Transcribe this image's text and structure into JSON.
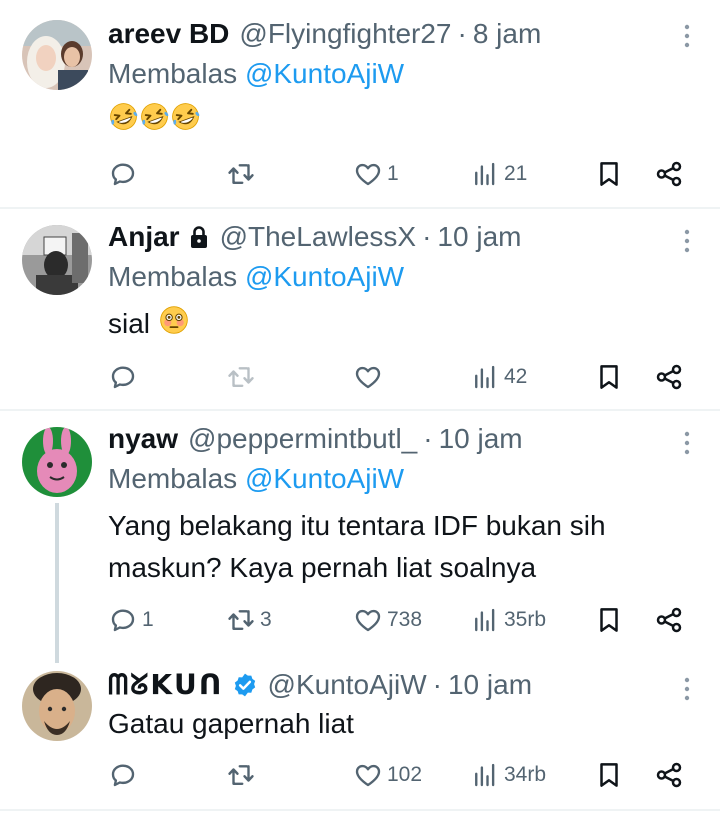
{
  "colors": {
    "text": "#0f1419",
    "muted": "#536471",
    "link": "#1d9bf0",
    "divider": "#eff3f4",
    "verified": "#1d9bf0"
  },
  "tweets": [
    {
      "name": "areev BD",
      "handle": "@Flyingfighter27",
      "dot": "·",
      "time": "8 jam",
      "reply_label": "Membalas",
      "reply_mention": "@KuntoAjiW",
      "emoji": "rolling-on-floor-laughing ×3",
      "counts": {
        "reply": "",
        "retweet": "",
        "like": "1",
        "views": "21"
      }
    },
    {
      "name": "Anjar",
      "handle": "@TheLawlessX",
      "dot": "·",
      "time": "10 jam",
      "reply_label": "Membalas",
      "reply_mention": "@KuntoAjiW",
      "text": "sial",
      "emoji": "flushed-face",
      "counts": {
        "reply": "",
        "retweet": "",
        "like": "",
        "views": "42"
      }
    },
    {
      "name": "nyaw",
      "handle": "@peppermintbutl_",
      "dot": "·",
      "time": "10 jam",
      "reply_label": "Membalas",
      "reply_mention": "@KuntoAjiW",
      "text_line1": "Yang belakang itu tentara IDF bukan sih",
      "text_line2": "maskun? Kaya pernah liat soalnya",
      "counts": {
        "reply": "1",
        "retweet": "3",
        "like": "738",
        "views": "35rb"
      }
    },
    {
      "name": "ᗰᘜKᑌᑎ",
      "handle": "@KuntoAjiW",
      "dot": "·",
      "time": "10 jam",
      "text": "Gatau gapernah liat",
      "counts": {
        "reply": "",
        "retweet": "",
        "like": "102",
        "views": "34rb"
      }
    }
  ]
}
